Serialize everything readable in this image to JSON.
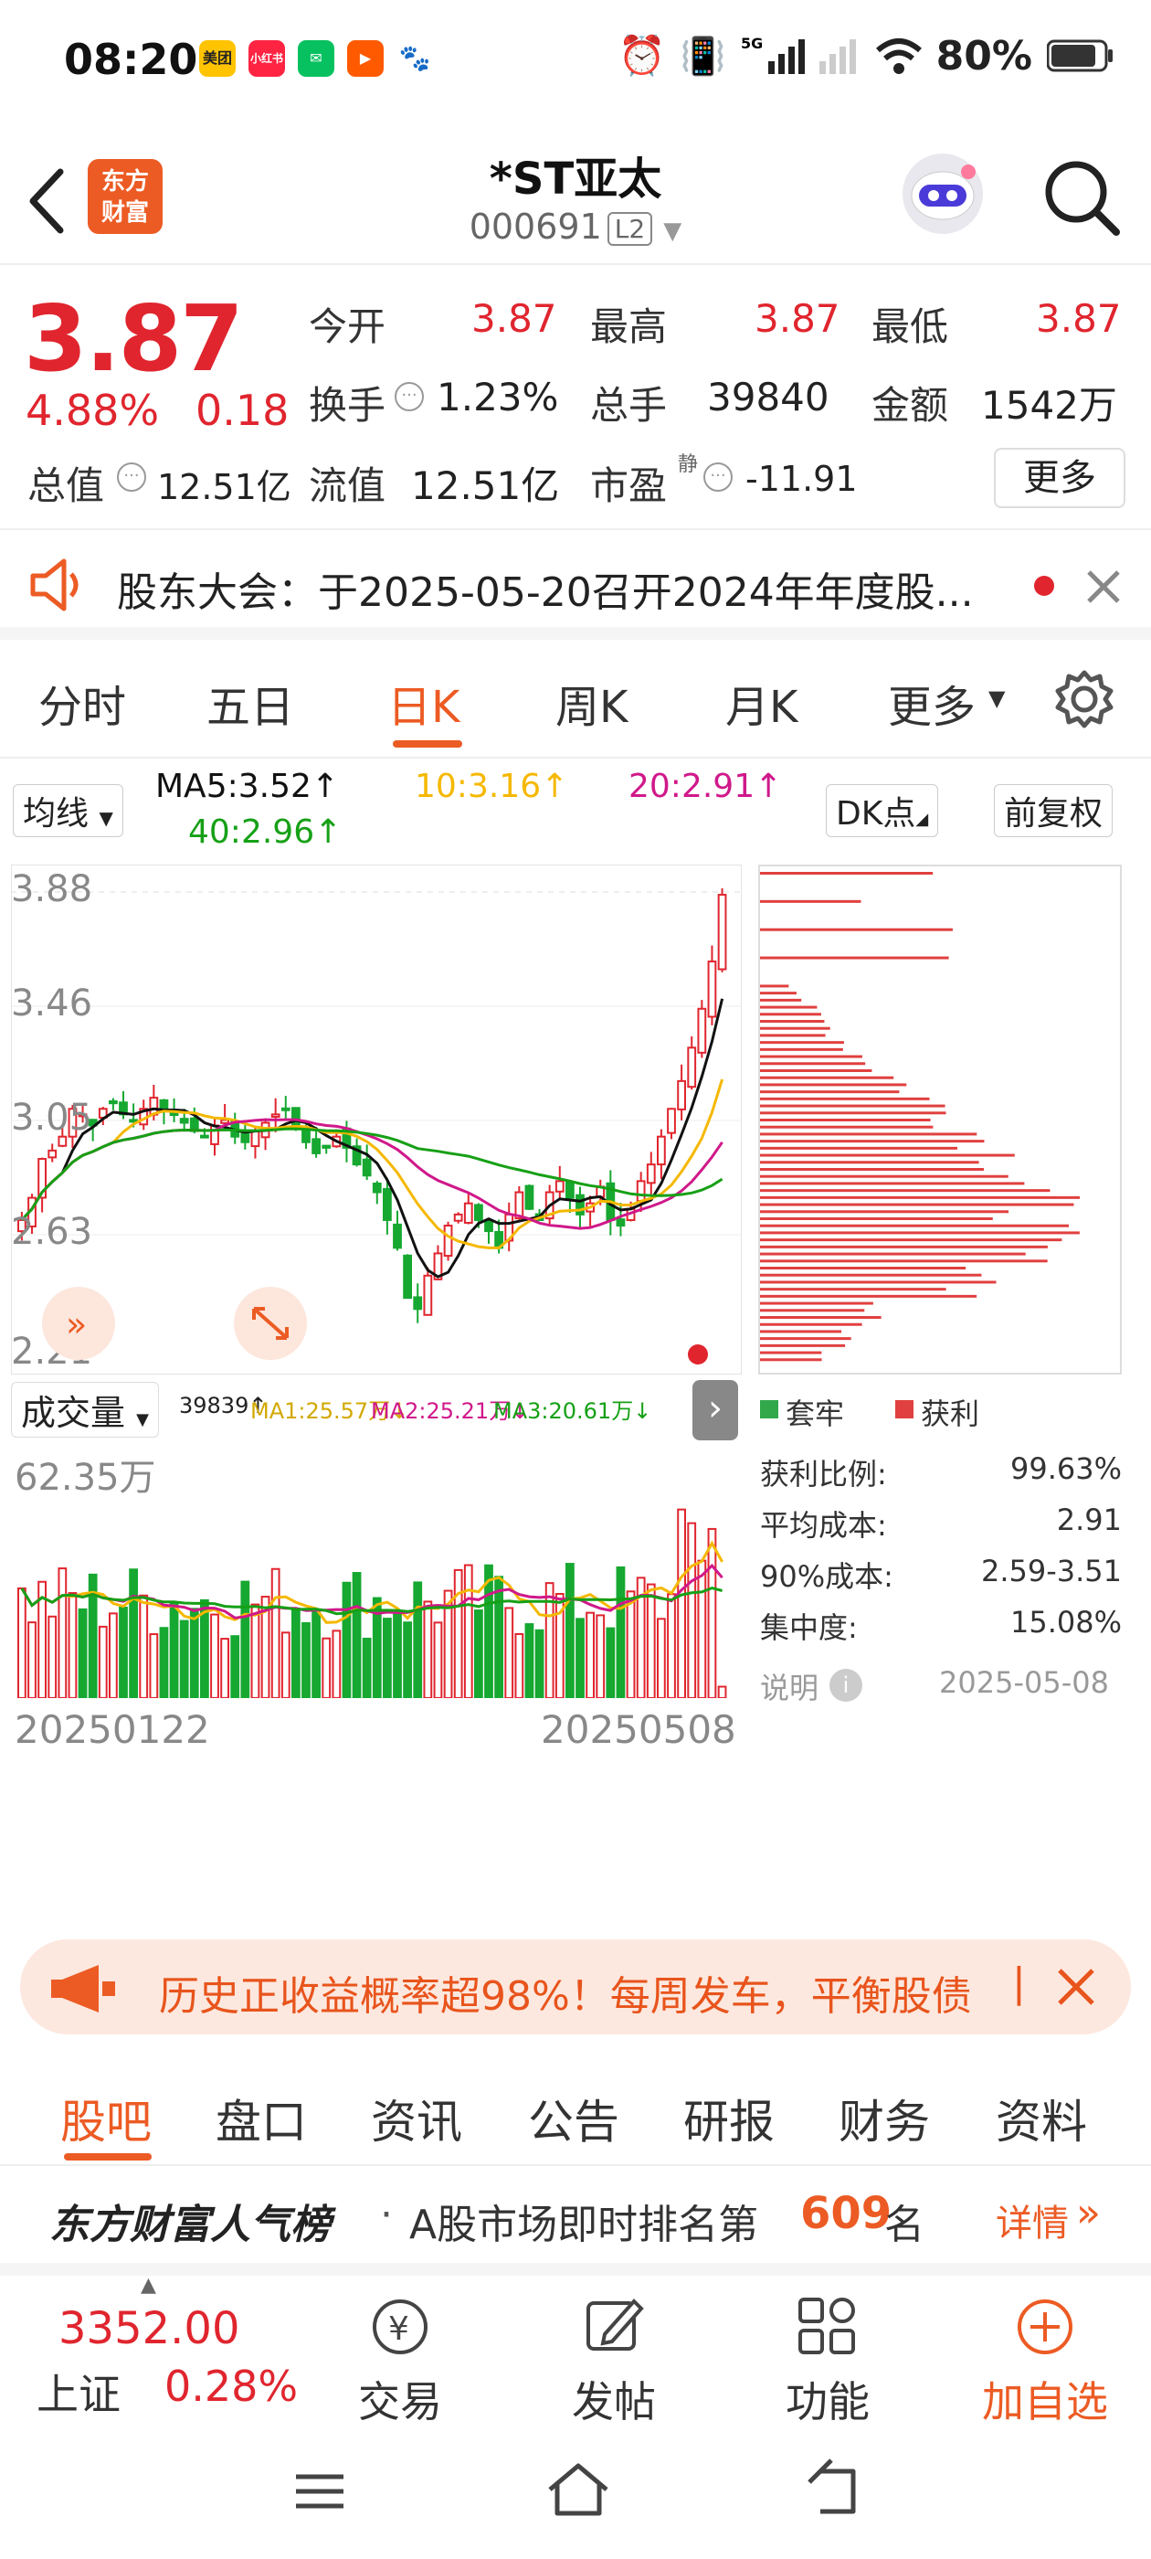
{
  "status": {
    "time": "08:20",
    "battery": "80%",
    "net": "5G",
    "apps": [
      {
        "name": "美团",
        "color": "#ffc300"
      },
      {
        "name": "小红书",
        "color": "#ff2442"
      },
      {
        "name": "微信",
        "color": "#07c160"
      },
      {
        "name": "快",
        "color": "#ff5a00"
      },
      {
        "name": "百度",
        "color": "#2932e1"
      }
    ]
  },
  "header": {
    "logo": "东方\n财富",
    "title": "*ST亚太",
    "code": "000691",
    "level": "L2"
  },
  "quote": {
    "price": "3.87",
    "pct": "4.88%",
    "chg": "0.18",
    "row1": [
      {
        "l": "今开",
        "v": "3.87"
      },
      {
        "l": "最高",
        "v": "3.87"
      },
      {
        "l": "最低",
        "v": "3.87"
      }
    ],
    "row2": [
      {
        "l": "换手",
        "v": "1.23%"
      },
      {
        "l": "总手",
        "v": "39840"
      },
      {
        "l": "金额",
        "v": "1542万"
      }
    ],
    "row3": [
      {
        "l": "总值",
        "v": "12.51亿"
      },
      {
        "l": "流值",
        "v": "12.51亿"
      },
      {
        "l": "市盈",
        "sup": "静",
        "v": "-11.91"
      }
    ],
    "more": "更多"
  },
  "notice": {
    "text": "股东大会：于2025-05-20召开2024年年度股..."
  },
  "tabs": [
    "分时",
    "五日",
    "日K",
    "周K",
    "月K",
    "更多"
  ],
  "chart": {
    "ma_select": "均线",
    "ma5": "MA5:3.52↑",
    "ma10": "10:3.16↑",
    "ma20": "20:2.91↑",
    "ma40": "40:2.96↑",
    "dk": "DK点",
    "fq": "前复权",
    "colors": {
      "ma5": "#111111",
      "ma10": "#f5b800",
      "ma20": "#d0188a",
      "ma40": "#16a016",
      "up": "#e0252e",
      "down": "#16a831"
    },
    "price_ticks": [
      "3.88",
      "3.46",
      "3.05",
      "2.63",
      "2.21"
    ],
    "vol_select": "成交量",
    "vol_value": "39839↑",
    "vma1": "MA1:25.57万↓",
    "vma2": "MA2:25.21万↓",
    "vma3": "MA3:20.61万↓",
    "vol_max": "62.35万",
    "date_start": "20250122",
    "date_end": "20250508"
  },
  "chips": {
    "legend_trapped": "套牢",
    "legend_profit": "获利",
    "rows": [
      {
        "l": "获利比例:",
        "v": "99.63%"
      },
      {
        "l": "平均成本:",
        "v": "2.91"
      },
      {
        "l": "90%成本:",
        "v": "2.59-3.51"
      },
      {
        "l": "集中度:",
        "v": "15.08%"
      }
    ],
    "note": "说明",
    "date": "2025-05-08"
  },
  "banner": {
    "text": "历史正收益概率超98%！每周发车，平衡股债"
  },
  "nav2": [
    "股吧",
    "盘口",
    "资讯",
    "公告",
    "研报",
    "财务",
    "资料"
  ],
  "rank": {
    "brand": "东方财富人气榜",
    "text": "A股市场即时排名第",
    "num": "609",
    "suffix": "名",
    "detail": "详情"
  },
  "bottom": {
    "index_val": "3352.00",
    "index_name": "上证",
    "index_pct": "0.28%",
    "items": [
      "交易",
      "发帖",
      "功能",
      "加自选"
    ]
  }
}
